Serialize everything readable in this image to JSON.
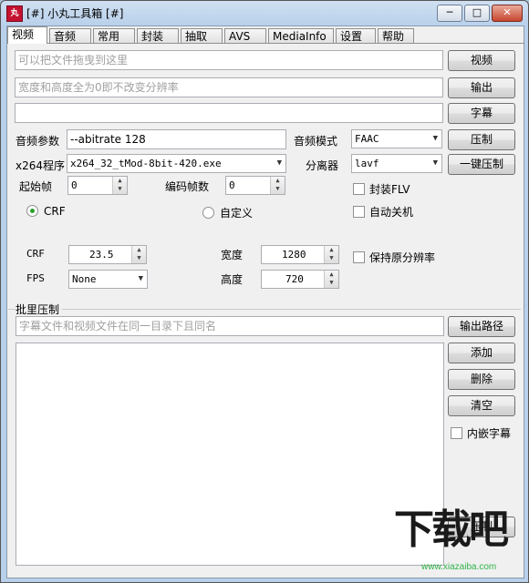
{
  "window": {
    "title": "[#] 小丸工具箱 [#]",
    "icon_text": "丸",
    "minimize_glyph": "─",
    "maximize_glyph": "□",
    "close_glyph": "✕"
  },
  "tabs": [
    "视频",
    "音频",
    "常用",
    "封装",
    "抽取",
    "AVS",
    "MediaInfo",
    "设置",
    "帮助"
  ],
  "video": {
    "drop_placeholder": "可以把文件拖曳到这里",
    "resolution_placeholder": "宽度和高度全为0即不改变分辨率",
    "subtitle_input": "",
    "buttons": {
      "video": "视频",
      "output": "输出",
      "subtitle": "字幕",
      "compress": "压制",
      "one_click": "一键压制"
    },
    "audio_params_label": "音频参数",
    "audio_params_value": "--abitrate 128",
    "audio_mode_label": "音频模式",
    "audio_mode_value": "FAAC",
    "x264_label": "x264程序",
    "x264_value": "x264_32_tMod-8bit-420.exe",
    "splitter_label": "分离器",
    "splitter_value": "lavf",
    "start_frame_label": "起始帧",
    "start_frame_value": "0",
    "encode_frames_label": "编码帧数",
    "encode_frames_value": "0",
    "mux_flv_label": "封装FLV",
    "auto_shutdown_label": "自动关机",
    "crf_radio_label": "CRF",
    "custom_radio_label": "自定义",
    "crf_label": "CRF",
    "crf_value": "23.5",
    "width_label": "宽度",
    "width_value": "1280",
    "keep_res_label": "保持原分辨率",
    "fps_label": "FPS",
    "fps_value": "None",
    "height_label": "高度",
    "height_value": "720"
  },
  "batch": {
    "group_label": "批里压制",
    "hint_placeholder": "字幕文件和视频文件在同一目录下且同名",
    "buttons": {
      "output_path": "输出路径",
      "add": "添加",
      "delete": "删除",
      "clear": "清空",
      "compress": "压制"
    },
    "embed_subtitle_label": "内嵌字幕"
  },
  "watermark": {
    "logo_text": "下载吧",
    "url": "www.xiazaiba.com"
  },
  "colors": {
    "accent_green": "#2fb34a",
    "title_gradient": "#b8d0ea"
  }
}
